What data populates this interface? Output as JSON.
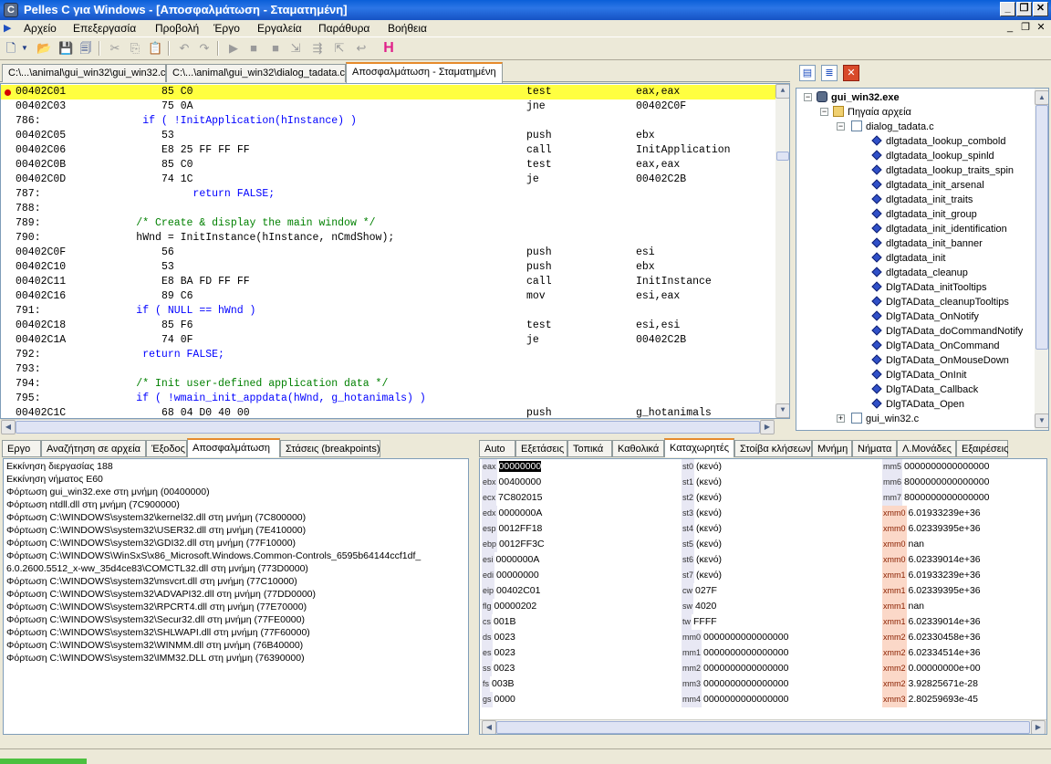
{
  "window": {
    "title": "Pelles C για Windows - [Αποσφαλμάτωση - Σταματημένη]",
    "min_glyph": "_",
    "max_glyph": "❐",
    "close_glyph": "✕"
  },
  "menu": {
    "items": [
      "Αρχείο",
      "Επεξεργασία",
      "Προβολή",
      "Έργο",
      "Εργαλεία",
      "Παράθυρα",
      "Βοήθεια"
    ],
    "mdi_controls": [
      "_",
      "❐",
      "✕"
    ]
  },
  "editor_tabs": [
    "C:\\...\\animal\\gui_win32\\gui_win32.c",
    "C:\\...\\animal\\gui_win32\\dialog_tadata.c",
    "Αποσφαλμάτωση - Σταματημένη"
  ],
  "disasm": [
    {
      "kind": "asm",
      "addr": "00402C01",
      "bytes": "85 C0",
      "mn": "test",
      "op": "eax,eax",
      "current": true,
      "breakpoint": true
    },
    {
      "kind": "asm",
      "addr": "00402C03",
      "bytes": "75 0A",
      "mn": "jne",
      "op": "00402C0F"
    },
    {
      "kind": "src",
      "no": "786:",
      "code": "        if ( !InitApplication(hInstance) )",
      "style": "kw"
    },
    {
      "kind": "asm",
      "addr": "00402C05",
      "bytes": "53",
      "mn": "push",
      "op": "ebx"
    },
    {
      "kind": "asm",
      "addr": "00402C06",
      "bytes": "E8 25 FF FF FF",
      "mn": "call",
      "op": "InitApplication"
    },
    {
      "kind": "asm",
      "addr": "00402C0B",
      "bytes": "85 C0",
      "mn": "test",
      "op": "eax,eax"
    },
    {
      "kind": "asm",
      "addr": "00402C0D",
      "bytes": "74 1C",
      "mn": "je",
      "op": "00402C2B"
    },
    {
      "kind": "src",
      "no": "787:",
      "code": "                return FALSE;",
      "style": "kw"
    },
    {
      "kind": "src",
      "no": "788:",
      "code": "",
      "style": ""
    },
    {
      "kind": "src",
      "no": "789:",
      "code": "       /* Create & display the main window */",
      "style": "cm"
    },
    {
      "kind": "src",
      "no": "790:",
      "code": "       hWnd = InitInstance(hInstance, nCmdShow);",
      "style": ""
    },
    {
      "kind": "asm",
      "addr": "00402C0F",
      "bytes": "56",
      "mn": "push",
      "op": "esi"
    },
    {
      "kind": "asm",
      "addr": "00402C10",
      "bytes": "53",
      "mn": "push",
      "op": "ebx"
    },
    {
      "kind": "asm",
      "addr": "00402C11",
      "bytes": "E8 BA FD FF FF",
      "mn": "call",
      "op": "InitInstance"
    },
    {
      "kind": "asm",
      "addr": "00402C16",
      "bytes": "89 C6",
      "mn": "mov",
      "op": "esi,eax"
    },
    {
      "kind": "src",
      "no": "791:",
      "code": "       if ( NULL == hWnd )",
      "style": "kw"
    },
    {
      "kind": "asm",
      "addr": "00402C18",
      "bytes": "85 F6",
      "mn": "test",
      "op": "esi,esi"
    },
    {
      "kind": "asm",
      "addr": "00402C1A",
      "bytes": "74 0F",
      "mn": "je",
      "op": "00402C2B"
    },
    {
      "kind": "src",
      "no": "792:",
      "code": "        return FALSE;",
      "style": "kw"
    },
    {
      "kind": "src",
      "no": "793:",
      "code": "",
      "style": ""
    },
    {
      "kind": "src",
      "no": "794:",
      "code": "       /* Init user-defined application data */",
      "style": "cm"
    },
    {
      "kind": "src",
      "no": "795:",
      "code": "       if ( !wmain_init_appdata(hWnd, g_hotanimals) )",
      "style": "kw"
    },
    {
      "kind": "asm",
      "addr": "00402C1C",
      "bytes": "68 04 D0 40 00",
      "mn": "push",
      "op": "g_hotanimals"
    }
  ],
  "project": {
    "root": "gui_win32.exe",
    "folder": "Πηγαία αρχεία",
    "file": "dialog_tadata.c",
    "functions": [
      "dlgtadata_lookup_combold",
      "dlgtadata_lookup_spinld",
      "dlgtadata_lookup_traits_spin",
      "dlgtadata_init_arsenal",
      "dlgtadata_init_traits",
      "dlgtadata_init_group",
      "dlgtadata_init_identification",
      "dlgtadata_init_banner",
      "dlgtadata_init",
      "dlgtadata_cleanup",
      "DlgTAData_initTooltips",
      "DlgTAData_cleanupTooltips",
      "DlgTAData_OnNotify",
      "DlgTAData_doCommandNotify",
      "DlgTAData_OnCommand",
      "DlgTAData_OnMouseDown",
      "DlgTAData_OnInit",
      "DlgTAData_Callback",
      "DlgTAData_Open"
    ],
    "file2": "gui_win32.c"
  },
  "bottom_left_tabs": [
    "Εργο",
    "Αναζήτηση σε αρχεία",
    "Έξοδος",
    "Αποσφαλμάτωση",
    "Στάσεις (breakpoints)"
  ],
  "output_lines": [
    "Εκκίνηση διεργασίας 188",
    "Εκκίνηση νήματος E60",
    "Φόρτωση gui_win32.exe στη μνήμη (00400000)",
    "Φόρτωση ntdll.dll στη μνήμη (7C900000)",
    "Φόρτωση C:\\WINDOWS\\system32\\kernel32.dll στη μνήμη (7C800000)",
    "Φόρτωση C:\\WINDOWS\\system32\\USER32.dll στη μνήμη (7E410000)",
    "Φόρτωση C:\\WINDOWS\\system32\\GDI32.dll στη μνήμη (77F10000)",
    "Φόρτωση C:\\WINDOWS\\WinSxS\\x86_Microsoft.Windows.Common-Controls_6595b64144ccf1df_",
    "6.0.2600.5512_x-ww_35d4ce83\\COMCTL32.dll στη μνήμη (773D0000)",
    "Φόρτωση C:\\WINDOWS\\system32\\msvcrt.dll στη μνήμη (77C10000)",
    "Φόρτωση C:\\WINDOWS\\system32\\ADVAPI32.dll στη μνήμη (77DD0000)",
    "Φόρτωση C:\\WINDOWS\\system32\\RPCRT4.dll στη μνήμη (77E70000)",
    "Φόρτωση C:\\WINDOWS\\system32\\Secur32.dll στη μνήμη (77FE0000)",
    "Φόρτωση C:\\WINDOWS\\system32\\SHLWAPI.dll στη μνήμη (77F60000)",
    "Φόρτωση C:\\WINDOWS\\system32\\WINMM.dll στη μνήμη (76B40000)",
    "Φόρτωση C:\\WINDOWS\\system32\\IMM32.DLL στη μνήμη (76390000)"
  ],
  "bottom_right_tabs": [
    "Auto",
    "Εξετάσεις",
    "Τοπικά",
    "Καθολικά",
    "Καταχωρητές",
    "Στοίβα κλήσεων",
    "Μνήμη",
    "Νήματα",
    "Λ.Μονάδες",
    "Εξαιρέσεις"
  ],
  "registers": {
    "col1": [
      {
        "n": "eax",
        "v": "00000000",
        "sel": true
      },
      {
        "n": "ebx",
        "v": "00400000"
      },
      {
        "n": "ecx",
        "v": "7C802015"
      },
      {
        "n": "edx",
        "v": "0000000A"
      },
      {
        "n": "esp",
        "v": "0012FF18"
      },
      {
        "n": "ebp",
        "v": "0012FF3C"
      },
      {
        "n": "esi",
        "v": "0000000A"
      },
      {
        "n": "edi",
        "v": "00000000"
      },
      {
        "n": "eip",
        "v": "00402C01"
      },
      {
        "n": "flg",
        "v": "00000202"
      },
      {
        "n": "cs",
        "v": "001B"
      },
      {
        "n": "ds",
        "v": "0023"
      },
      {
        "n": "es",
        "v": "0023"
      },
      {
        "n": "ss",
        "v": "0023"
      },
      {
        "n": "fs",
        "v": "003B"
      },
      {
        "n": "gs",
        "v": "0000"
      }
    ],
    "col2": [
      {
        "n": "st0",
        "v": "(κενό)"
      },
      {
        "n": "st1",
        "v": "(κενό)"
      },
      {
        "n": "st2",
        "v": "(κενό)"
      },
      {
        "n": "st3",
        "v": "(κενό)"
      },
      {
        "n": "st4",
        "v": "(κενό)"
      },
      {
        "n": "st5",
        "v": "(κενό)"
      },
      {
        "n": "st6",
        "v": "(κενό)"
      },
      {
        "n": "st7",
        "v": "(κενό)"
      },
      {
        "n": "cw",
        "v": "027F"
      },
      {
        "n": "sw",
        "v": "4020"
      },
      {
        "n": "tw",
        "v": "FFFF"
      },
      {
        "n": "mm0",
        "v": "0000000000000000"
      },
      {
        "n": "mm1",
        "v": "0000000000000000"
      },
      {
        "n": "mm2",
        "v": "0000000000000000"
      },
      {
        "n": "mm3",
        "v": "0000000000000000"
      },
      {
        "n": "mm4",
        "v": "0000000000000000"
      }
    ],
    "col3": [
      {
        "n": "mm5",
        "v": "0000000000000000"
      },
      {
        "n": "mm6",
        "v": "8000000000000000"
      },
      {
        "n": "mm7",
        "v": "8000000000000000"
      },
      {
        "n": "xmm0",
        "v": "6.01933239e+36",
        "x": true
      },
      {
        "n": "xmm0",
        "v": "6.02339395e+36",
        "x": true
      },
      {
        "n": "xmm0",
        "v": "nan",
        "x": true
      },
      {
        "n": "xmm0",
        "v": "6.02339014e+36",
        "x": true
      },
      {
        "n": "xmm1",
        "v": "6.01933239e+36",
        "x": true
      },
      {
        "n": "xmm1",
        "v": "6.02339395e+36",
        "x": true
      },
      {
        "n": "xmm1",
        "v": "nan",
        "x": true
      },
      {
        "n": "xmm1",
        "v": "6.02339014e+36",
        "x": true
      },
      {
        "n": "xmm2",
        "v": "6.02330458e+36",
        "x": true
      },
      {
        "n": "xmm2",
        "v": "6.02334514e+36",
        "x": true
      },
      {
        "n": "xmm2",
        "v": "0.00000000e+00",
        "x": true
      },
      {
        "n": "xmm2",
        "v": "3.92825671e-28",
        "x": true
      },
      {
        "n": "xmm3",
        "v": "2.80259693e-45",
        "x": true
      }
    ]
  }
}
